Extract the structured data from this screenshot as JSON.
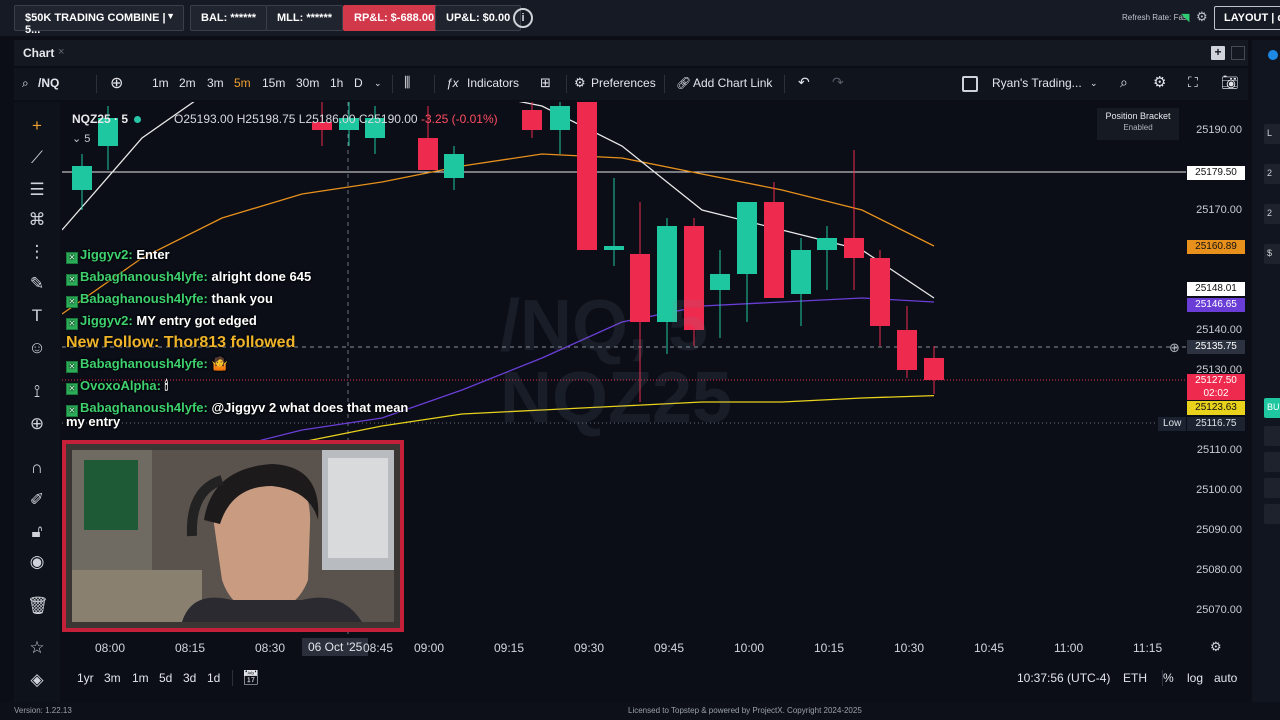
{
  "topbar": {
    "account": "$50K TRADING COMBINE | 5...",
    "bal": "BAL: ******",
    "mll": "MLL: ******",
    "rpl": "RP&L: $-688.00",
    "upl": "UP&L: $0.00",
    "info_icon": "i",
    "refresh_rate": "Refresh Rate: Fast",
    "layout": "LAYOUT | de"
  },
  "panel": {
    "title": "Chart",
    "close": "×"
  },
  "toolbar": {
    "symbol": "/NQ",
    "intervals": [
      "1m",
      "2m",
      "3m",
      "5m",
      "15m",
      "30m",
      "1h",
      "D"
    ],
    "active_interval": "5m",
    "indicators": "Indicators",
    "preferences": "Preferences",
    "add_chart_link": "Add Chart Link",
    "template": "Ryan's Trading..."
  },
  "chart_header": {
    "symbol": "NQZ25 · 5",
    "open": "O25193.00",
    "high": "H25198.75",
    "low": "L25186.00",
    "close": "C25190.00",
    "change": "-3.25 (-0.01%)",
    "sub": "5"
  },
  "watermark": {
    "line1": "/NQ, 5",
    "line2": "NQZ25"
  },
  "position_bracket": {
    "title": "Position Bracket",
    "status": "Enabled"
  },
  "yaxis": {
    "ticks": [
      "25190.00",
      "25170.00",
      "25140.00",
      "25130.00",
      "25110.00",
      "25100.00",
      "25090.00",
      "25080.00",
      "25070.00"
    ],
    "labels": {
      "line": "25179.50",
      "orange": "25160.89",
      "white": "25148.01",
      "purple": "25146.65",
      "crosshair": "25135.75",
      "last": "25127.50",
      "countdown": "02:02",
      "yellow": "25123.63",
      "low_tag": "Low",
      "low": "25116.75"
    }
  },
  "xaxis": {
    "ticks": [
      "08:00",
      "08:15",
      "08:30",
      "08:45",
      "09:00",
      "09:15",
      "09:30",
      "09:45",
      "10:00",
      "10:15",
      "10:30",
      "10:45",
      "11:00",
      "11:15"
    ],
    "cursor_date": "06 Oct '25"
  },
  "bottombar": {
    "ranges": [
      "1yr",
      "3m",
      "1m",
      "5d",
      "3d",
      "1d"
    ],
    "clock": "10:37:56 (UTC-4)",
    "session": "ETH",
    "pct": "%",
    "log": "log",
    "auto": "auto"
  },
  "chat": [
    {
      "user": "Jiggyv2:",
      "msg": "Enter"
    },
    {
      "user": "Babaghanoush4lyfe:",
      "msg": "alright done 645"
    },
    {
      "user": "Babaghanoush4lyfe:",
      "msg": "thank you"
    },
    {
      "user": "Jiggyv2:",
      "msg": "MY entry got edged"
    },
    {
      "user": "Babaghanoush4lyfe:",
      "msg": "🤷"
    },
    {
      "user": "OvoxoAlpha:",
      "msg": "🕯"
    },
    {
      "user": "Babaghanoush4lyfe:",
      "msg": "@Jiggyv 2 what does that mean"
    },
    {
      "user": "",
      "msg": "my entry"
    }
  ],
  "follow_alert": "New Follow: Thor813 followed",
  "footer": {
    "version": "Version: 1.22.13",
    "license": "Licensed to Topstep & powered by ProjectX. Copyright 2024-2025"
  },
  "colors": {
    "bull": "#1fc7a0",
    "bear": "#ee2a4e",
    "accent": "#f0a030",
    "rpl": "#d1384a"
  }
}
